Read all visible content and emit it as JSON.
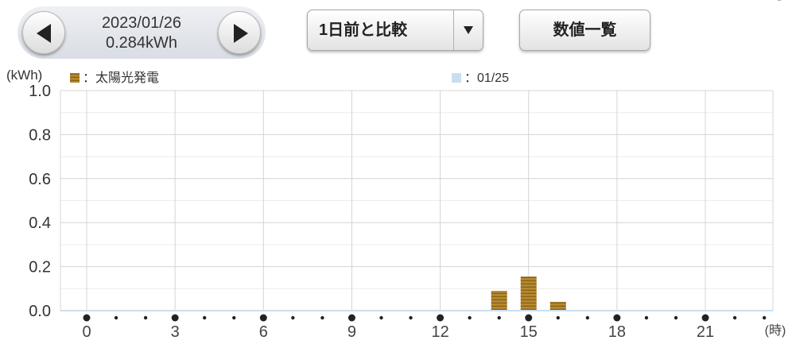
{
  "header": {
    "date": "2023/01/26",
    "total": "0.284kWh",
    "compare_label": "1日前と比較",
    "list_button": "数値一覧",
    "prev_icon": "triangle-left-icon",
    "next_icon": "triangle-right-icon",
    "dropdown_icon": "triangle-down-icon"
  },
  "chart_data": {
    "type": "bar",
    "ylabel": "(kWh)",
    "xlabel": "(時)",
    "ylim": [
      0,
      1.0
    ],
    "yticks": [
      0.0,
      0.2,
      0.4,
      0.6,
      0.8,
      1.0
    ],
    "ytick_labels": [
      "0.0",
      "0.2",
      "0.4",
      "0.6",
      "0.8",
      "1.0"
    ],
    "xticks": [
      0,
      3,
      6,
      9,
      12,
      15,
      18,
      21
    ],
    "xtick_labels": [
      "0",
      "3",
      "6",
      "9",
      "12",
      "15",
      "18",
      "21"
    ],
    "hours": [
      0,
      1,
      2,
      3,
      4,
      5,
      6,
      7,
      8,
      9,
      10,
      11,
      12,
      13,
      14,
      15,
      16,
      17,
      18,
      19,
      20,
      21,
      22,
      23
    ],
    "grid": true,
    "legend_position": "top",
    "series": [
      {
        "name": "：太陽光発電",
        "color": "#b8892f",
        "values": [
          0,
          0,
          0,
          0,
          0,
          0,
          0,
          0,
          0,
          0,
          0,
          0,
          0,
          0,
          0.09,
          0.155,
          0.04,
          0,
          0,
          0,
          0,
          0,
          0,
          0
        ]
      },
      {
        "name": "：01/25",
        "color": "#c9dff0",
        "values": [
          0,
          0,
          0,
          0,
          0,
          0,
          0,
          0,
          0,
          0,
          0,
          0,
          0,
          0,
          0,
          0,
          0,
          0,
          0,
          0,
          0,
          0,
          0,
          0
        ]
      }
    ]
  }
}
